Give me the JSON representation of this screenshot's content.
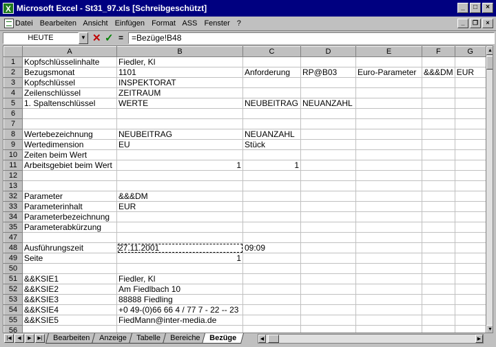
{
  "window": {
    "title": "Microsoft Excel - St31_97.xls  [Schreibgeschützt]",
    "app_icon": "X",
    "minimize": "_",
    "maximize": "□",
    "close": "×"
  },
  "menu": {
    "items": [
      "Datei",
      "Bearbeiten",
      "Ansicht",
      "Einfügen",
      "Format",
      "ASS",
      "Fenster",
      "?"
    ],
    "doc_minimize": "_",
    "doc_restore": "❐",
    "doc_close": "×"
  },
  "formula_bar": {
    "name_box": "HEUTE",
    "cancel": "✕",
    "ok": "✓",
    "equals": "=",
    "formula": "=Bezüge!B48"
  },
  "columns": [
    "A",
    "B",
    "C",
    "D",
    "E",
    "F",
    "G"
  ],
  "rows": [
    {
      "n": "1",
      "cells": [
        "Kopfschlüsselinhalte",
        "Fiedler, Kl",
        "",
        "",
        "",
        "",
        ""
      ]
    },
    {
      "n": "2",
      "cells": [
        "Bezugsmonat",
        "1101",
        "Anforderung",
        "RP@B03",
        "Euro-Parameter",
        "&&&DM",
        "EUR"
      ]
    },
    {
      "n": "3",
      "cells": [
        "Kopfschlüssel",
        "INSPEKTORAT",
        "",
        "",
        "",
        "",
        ""
      ]
    },
    {
      "n": "4",
      "cells": [
        "Zeilenschlüssel",
        "ZEITRAUM",
        "",
        "",
        "",
        "",
        ""
      ]
    },
    {
      "n": "5",
      "cells": [
        "1. Spaltenschlüssel",
        "WERTE",
        "NEUBEITRAG",
        "NEUANZAHL",
        "",
        "",
        ""
      ]
    },
    {
      "n": "6",
      "cells": [
        "",
        "",
        "",
        "",
        "",
        "",
        ""
      ]
    },
    {
      "n": "7",
      "cells": [
        "",
        "",
        "",
        "",
        "",
        "",
        ""
      ]
    },
    {
      "n": "8",
      "cells": [
        "Wertebezeichnung",
        "NEUBEITRAG",
        "NEUANZAHL",
        "",
        "",
        "",
        ""
      ]
    },
    {
      "n": "9",
      "cells": [
        "Wertedimension",
        "EU",
        "Stück",
        "",
        "",
        "",
        ""
      ]
    },
    {
      "n": "10",
      "cells": [
        "Zeiten beim Wert",
        "",
        "",
        "",
        "",
        "",
        ""
      ]
    },
    {
      "n": "11",
      "cells": [
        "Arbeitsgebiet beim Wert",
        "1",
        "1",
        "",
        "",
        "",
        ""
      ]
    },
    {
      "n": "12",
      "cells": [
        "",
        "",
        "",
        "",
        "",
        "",
        ""
      ]
    },
    {
      "n": "13",
      "cells": [
        "",
        "",
        "",
        "",
        "",
        "",
        ""
      ]
    },
    {
      "n": "32",
      "cells": [
        "Parameter",
        "&&&DM",
        "",
        "",
        "",
        "",
        ""
      ]
    },
    {
      "n": "33",
      "cells": [
        "Parameterinhalt",
        "EUR",
        "",
        "",
        "",
        "",
        ""
      ]
    },
    {
      "n": "34",
      "cells": [
        "Parameterbezeichnung",
        "",
        "",
        "",
        "",
        "",
        ""
      ]
    },
    {
      "n": "35",
      "cells": [
        "Parameterabkürzung",
        "",
        "",
        "",
        "",
        "",
        ""
      ]
    },
    {
      "n": "47",
      "cells": [
        "",
        "",
        "",
        "",
        "",
        "",
        ""
      ]
    },
    {
      "n": "48",
      "cells": [
        "Ausführungszeit",
        "27.11.2001",
        "09:09",
        "",
        "",
        "",
        ""
      ]
    },
    {
      "n": "49",
      "cells": [
        "Seite",
        "1",
        "",
        "",
        "",
        "",
        ""
      ]
    },
    {
      "n": "50",
      "cells": [
        "",
        "",
        "",
        "",
        "",
        "",
        ""
      ]
    },
    {
      "n": "51",
      "cells": [
        "&&KSIE1",
        "Fiedler, Kl",
        "",
        "",
        "",
        "",
        ""
      ]
    },
    {
      "n": "52",
      "cells": [
        "&&KSIE2",
        "Am Fiedlbach 10",
        "",
        "",
        "",
        "",
        ""
      ]
    },
    {
      "n": "53",
      "cells": [
        "&&KSIE3",
        "88888 Fiedling",
        "",
        "",
        "",
        "",
        ""
      ]
    },
    {
      "n": "54",
      "cells": [
        "&&KSIE4",
        "+0 49-(0)66 66 4 / 77 7 - 22 -- 23",
        "",
        "",
        "",
        "",
        ""
      ]
    },
    {
      "n": "55",
      "cells": [
        "&&KSIE5",
        "FiedMann@inter-media.de",
        "",
        "",
        "",
        "",
        ""
      ]
    },
    {
      "n": "56",
      "cells": [
        "",
        "",
        "",
        "",
        "",
        "",
        ""
      ]
    }
  ],
  "sheet_tabs": [
    "Bearbeiten",
    "Anzeige",
    "Tabelle",
    "Bereiche",
    "Bezüge"
  ],
  "active_tab": "Bezüge",
  "active_cell": "B48"
}
